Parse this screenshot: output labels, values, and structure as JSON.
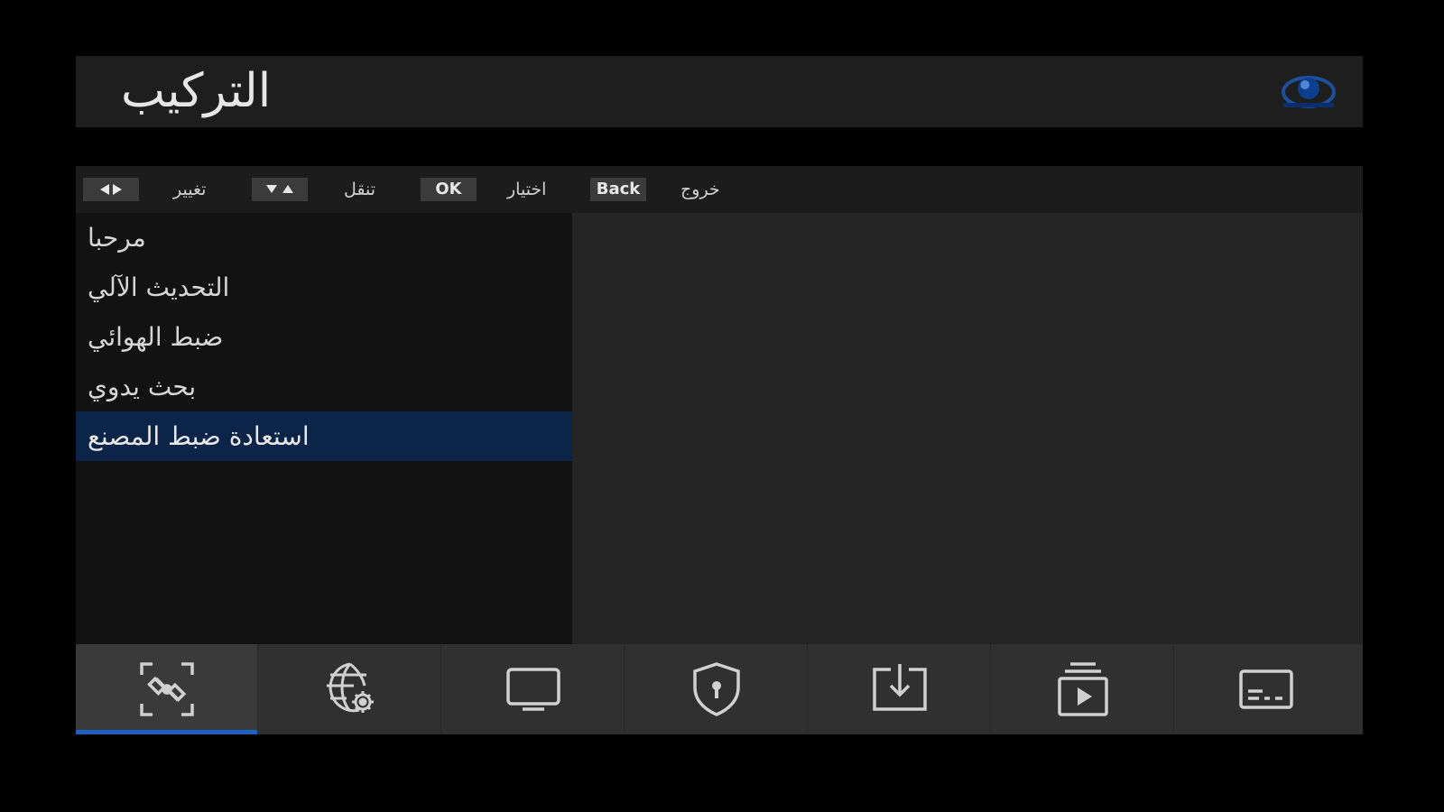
{
  "header": {
    "title": "التركيب",
    "logo_icon": "globe-logo-icon"
  },
  "hints": [
    {
      "key_icon": "left-right-arrows-icon",
      "label": "تغيير"
    },
    {
      "key_icon": "up-down-arrows-icon",
      "label": "تنقل"
    },
    {
      "key": "OK",
      "label": "اختيار"
    },
    {
      "key": "Back",
      "label": "خروج"
    }
  ],
  "menu": {
    "items": [
      {
        "label": "مرحبا"
      },
      {
        "label": "التحديث الآلي"
      },
      {
        "label": "ضبط الهوائي"
      },
      {
        "label": "بحث يدوي"
      },
      {
        "label": "استعادة ضبط المصنع"
      }
    ],
    "selected_index": 4
  },
  "tabs": [
    {
      "icon": "satellite-icon",
      "active": true
    },
    {
      "icon": "network-settings-icon",
      "active": false
    },
    {
      "icon": "tv-icon",
      "active": false
    },
    {
      "icon": "parental-lock-icon",
      "active": false
    },
    {
      "icon": "download-icon",
      "active": false
    },
    {
      "icon": "media-player-icon",
      "active": false
    },
    {
      "icon": "subtitles-icon",
      "active": false
    }
  ],
  "colors": {
    "accent": "#1f5fbf",
    "selected_row": "#0c2448",
    "background": "#000000"
  }
}
